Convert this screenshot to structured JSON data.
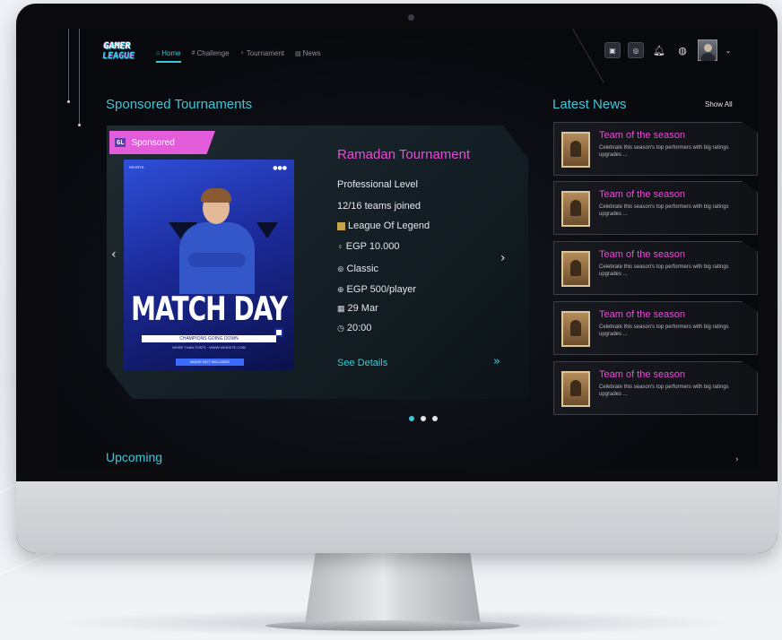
{
  "nav": {
    "items": [
      {
        "icon": "home-icon",
        "glyph": "⌂",
        "label": "Home",
        "active": true
      },
      {
        "icon": "trophy-icon",
        "glyph": "#",
        "label": "Challenge",
        "active": false
      },
      {
        "icon": "cup-icon",
        "glyph": "♀",
        "label": "Tournament",
        "active": false
      },
      {
        "icon": "news-icon",
        "glyph": "▤",
        "label": "News",
        "active": false
      }
    ]
  },
  "logo": {
    "line1": "GAMER",
    "line2": "LEAGUE"
  },
  "sponsored": {
    "title": "Sponsored Tournaments",
    "badge": "Sponsored",
    "badge_logo": "GL",
    "tournament": {
      "name": "Ramadan Tournament",
      "level": "Professional Level",
      "teams": "12/16 teams joined",
      "game": "League Of Legend",
      "prize": "EGP 10.000",
      "mode": "Classic",
      "fee": "EGP 500/player",
      "date": "29 Mar",
      "time": "20:00",
      "details": "See Details"
    },
    "poster": {
      "title": "MATCH DAY",
      "subtitle": "CHAMPIONS GOING DOWN",
      "small": "MORE THAN STATS · WWW.WEBSITE.COM",
      "footer": "IMAGE NOT INCLUDED",
      "brand": "SPORTS"
    }
  },
  "news": {
    "title": "Latest News",
    "show_all": "Show All",
    "items": [
      {
        "title": "Team of the season",
        "desc": "Celebrate this season's top performers with big ratings upgrades ..."
      },
      {
        "title": "Team of the season",
        "desc": "Celebrate this season's top performers with big ratings upgrades ..."
      },
      {
        "title": "Team of the season",
        "desc": "Celebrate this season's top performers with big ratings upgrades ..."
      },
      {
        "title": "Team of the season",
        "desc": "Celebrate this season's top performers with big ratings upgrades ..."
      },
      {
        "title": "Team of the season",
        "desc": "Celebrate this season's top performers with big ratings upgrades ..."
      }
    ]
  },
  "upcoming": {
    "title": "Upcoming"
  },
  "colors": {
    "accent": "#3cc8d8",
    "pink": "#e94bd8",
    "background": "#08090d"
  }
}
